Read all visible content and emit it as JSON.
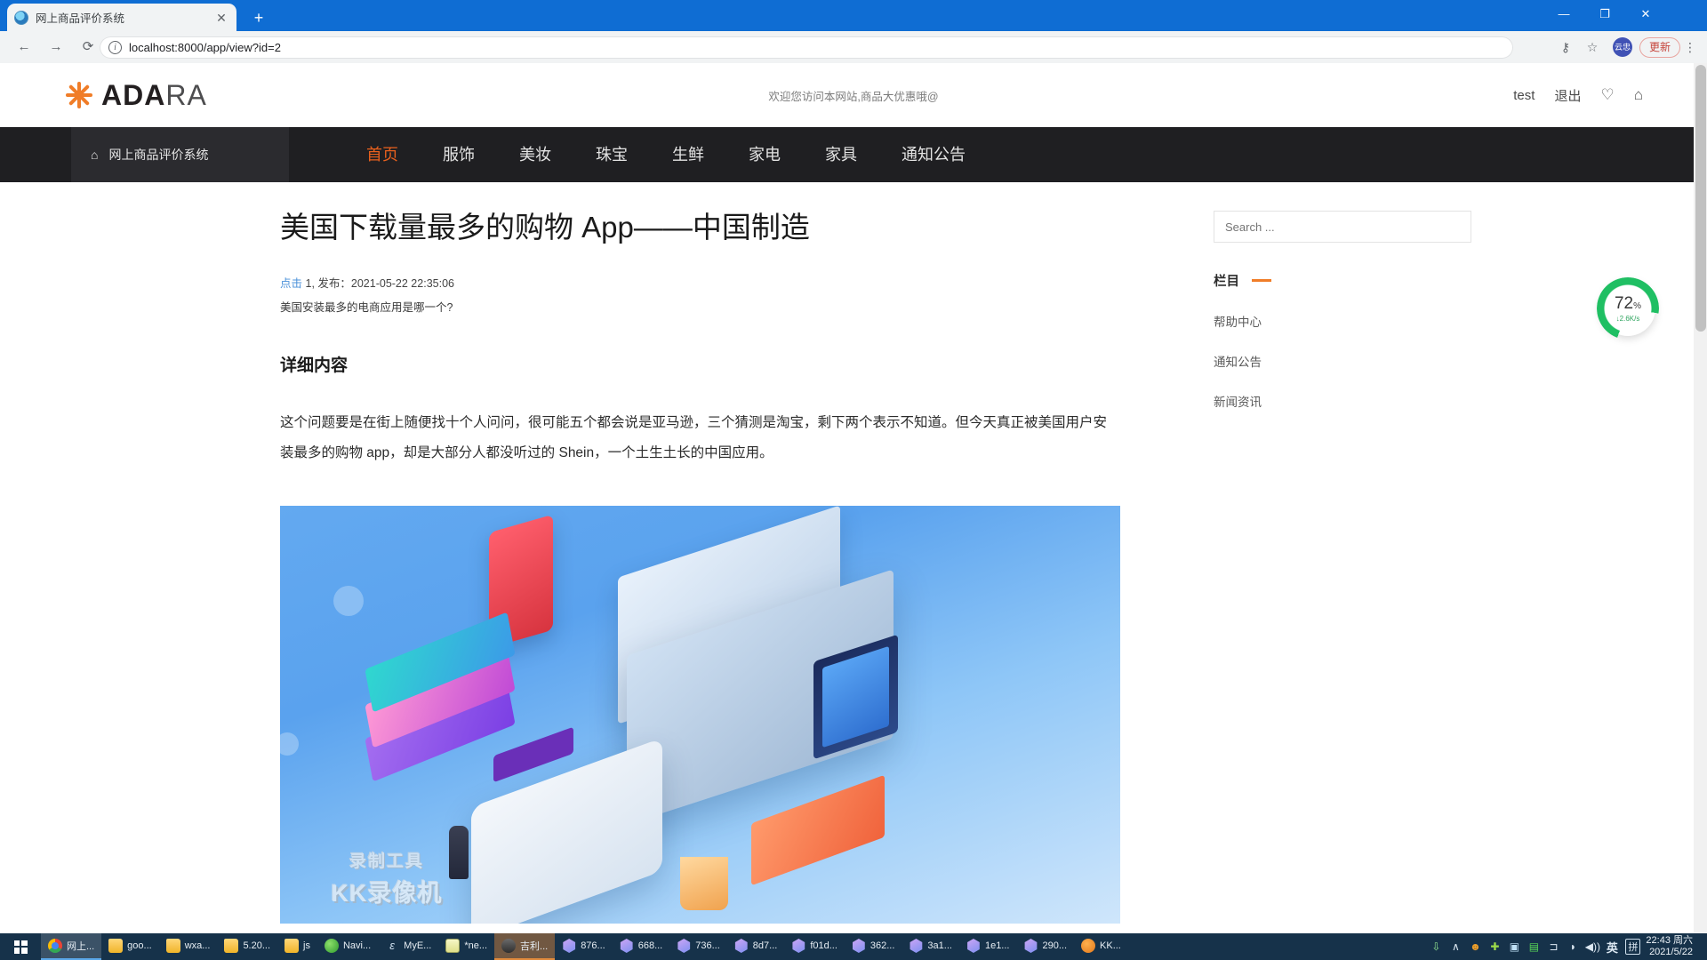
{
  "browser": {
    "tab_title": "网上商品评价系统",
    "tab_close": "✕",
    "new_tab": "+",
    "url": "localhost:8000/app/view?id=2",
    "info_icon": "i",
    "back_icon": "←",
    "forward_icon": "→",
    "reload_icon": "⟳",
    "key_icon": "⚷",
    "star_icon": "☆",
    "avatar_label": "云忠",
    "update_label": "更新",
    "kebab_icon": "⋮",
    "minimize": "—",
    "maximize": "❐",
    "close": "✕"
  },
  "site_header": {
    "logo_bold": "ADA",
    "logo_light": "RA",
    "welcome": "欢迎您访问本网站,商品大优惠哦@",
    "user": "test",
    "logout": "退出",
    "heart_icon": "♡",
    "bag_icon": "⌂"
  },
  "nav": {
    "brand": "网上商品评价系统",
    "home_icon": "⌂",
    "items": [
      {
        "label": "首页",
        "active": true
      },
      {
        "label": "服饰",
        "active": false
      },
      {
        "label": "美妆",
        "active": false
      },
      {
        "label": "珠宝",
        "active": false
      },
      {
        "label": "生鲜",
        "active": false
      },
      {
        "label": "家电",
        "active": false
      },
      {
        "label": "家具",
        "active": false
      },
      {
        "label": "通知公告",
        "active": false
      }
    ]
  },
  "article": {
    "title": "美国下载量最多的购物 App——中国制造",
    "clicks_label": "点击",
    "clicks_value": "1",
    "meta_rest": ", 发布：2021-05-22 22:35:06",
    "subtitle": "美国安装最多的电商应用是哪一个?",
    "section_title": "详细内容",
    "body": "这个问题要是在街上随便找十个人问问，很可能五个都会说是亚马逊，三个猜测是淘宝，剩下两个表示不知道。但今天真正被美国用户安装最多的购物 app，却是大部分人都没听过的 Shein，一个土生土长的中国应用。",
    "watermark_line1": "录制工具",
    "watermark_line2": "KK录像机"
  },
  "sidebar": {
    "search_placeholder": "Search ...",
    "section_title": "栏目",
    "links": [
      "帮助中心",
      "通知公告",
      "新闻资讯"
    ]
  },
  "widget": {
    "percent": "72",
    "percent_unit": "%",
    "speed": "2.6K/s",
    "down_icon": "↓",
    "accent_color": "#1fbf63"
  },
  "taskbar": {
    "start_icon": "windows-logo",
    "items": [
      {
        "label": "网上...",
        "icon": "chrome",
        "state": "active"
      },
      {
        "label": "goo...",
        "icon": "folder",
        "state": "normal"
      },
      {
        "label": "wxa...",
        "icon": "folder",
        "state": "normal"
      },
      {
        "label": "5.20...",
        "icon": "folder",
        "state": "normal"
      },
      {
        "label": "js",
        "icon": "folder",
        "state": "normal"
      },
      {
        "label": "Navi...",
        "icon": "navicat",
        "state": "normal"
      },
      {
        "label": "MyE...",
        "icon": "myeclipse",
        "state": "normal"
      },
      {
        "label": "*ne...",
        "icon": "notepad",
        "state": "normal"
      },
      {
        "label": "吉利...",
        "icon": "car",
        "state": "active2"
      },
      {
        "label": "876...",
        "icon": "hex",
        "state": "normal"
      },
      {
        "label": "668...",
        "icon": "hex",
        "state": "normal"
      },
      {
        "label": "736...",
        "icon": "hex",
        "state": "normal"
      },
      {
        "label": "8d7...",
        "icon": "hex",
        "state": "normal"
      },
      {
        "label": "f01d...",
        "icon": "hex",
        "state": "normal"
      },
      {
        "label": "362...",
        "icon": "hex",
        "state": "normal"
      },
      {
        "label": "3a1...",
        "icon": "hex",
        "state": "normal"
      },
      {
        "label": "1e1...",
        "icon": "hex",
        "state": "normal"
      },
      {
        "label": "290...",
        "icon": "hex",
        "state": "normal"
      },
      {
        "label": "KK...",
        "icon": "kk",
        "state": "normal"
      }
    ],
    "tray": {
      "usb_icon": "⇩",
      "chevron_icon": "∧",
      "smiley_icon": "☻",
      "plus_icon": "✚",
      "pic_icon": "▣",
      "disk_icon": "▤",
      "link_icon": "⊐",
      "wifi_icon": "◗",
      "volume_icon": "◀))",
      "ime_en": "英",
      "ime_pin": "拼",
      "time": "22:43 周六",
      "date": "2021/5/22"
    }
  }
}
